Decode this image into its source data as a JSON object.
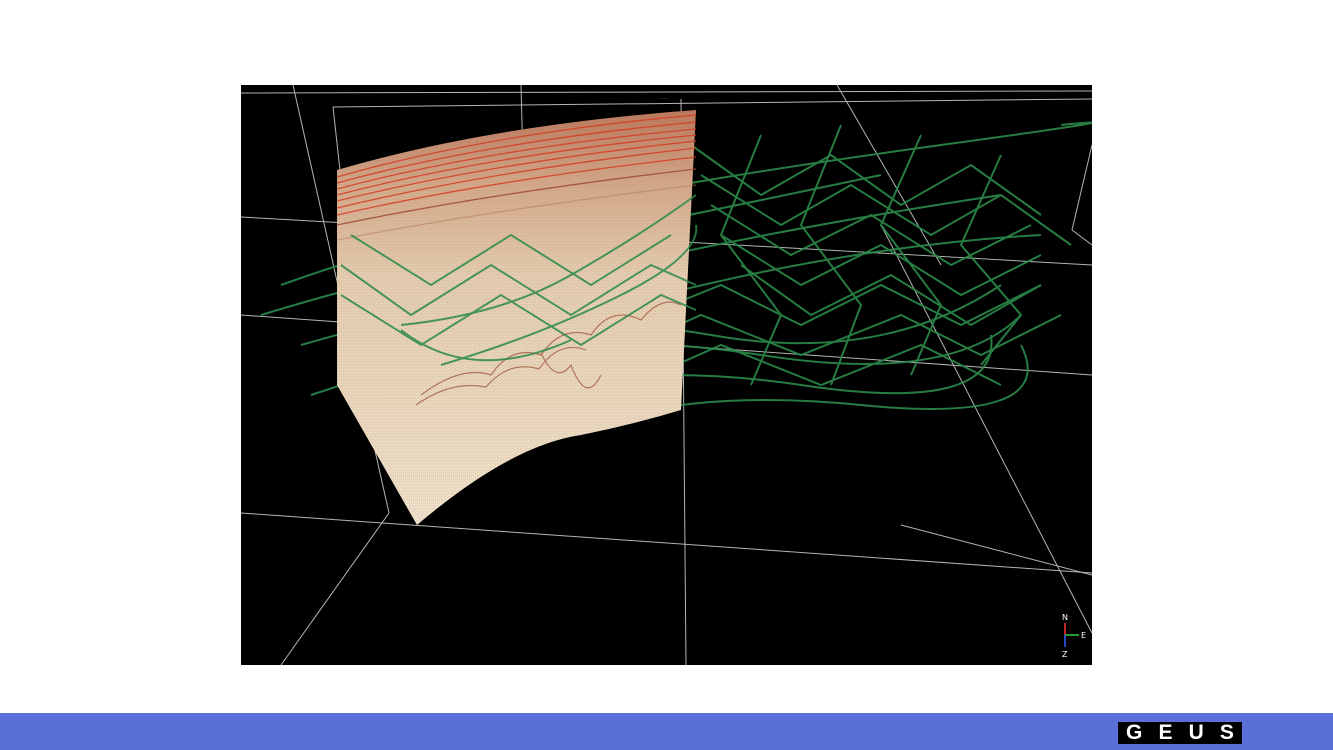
{
  "logo": {
    "letters": [
      "G",
      "E",
      "U",
      "S"
    ]
  },
  "colors": {
    "footer": "#5b6fd8",
    "grid": "#cfd8d0",
    "navlines": "#2b8a4a",
    "reflector": "#d63a22"
  },
  "axis_triad": {
    "north": "N",
    "east": "E",
    "down": "Z"
  }
}
